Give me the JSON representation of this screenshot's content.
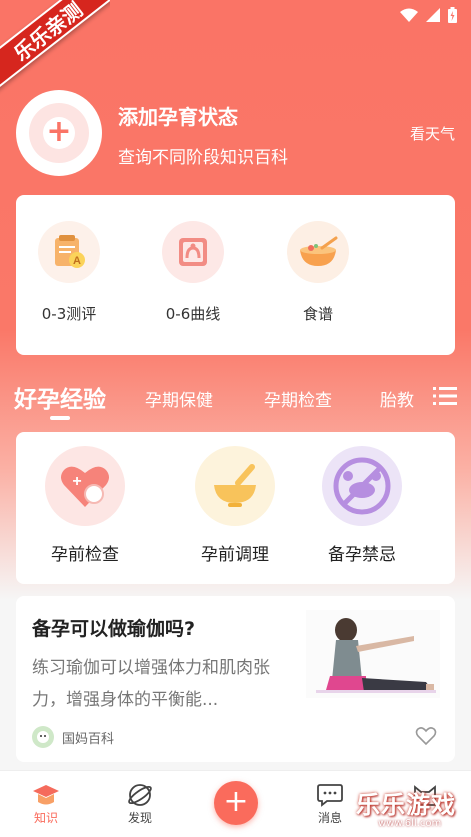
{
  "ribbon": {
    "text": "乐乐亲测"
  },
  "header": {
    "title": "添加孕育状态",
    "subtitle": "查询不同阶段知识百科",
    "weather_link": "看天气"
  },
  "tools": [
    {
      "label": "0-3测评",
      "icon": "assessment-icon"
    },
    {
      "label": "0-6曲线",
      "icon": "growth-curve-icon"
    },
    {
      "label": "食谱",
      "icon": "recipe-bowl-icon"
    }
  ],
  "tabs": [
    {
      "label": "好孕经验",
      "active": true
    },
    {
      "label": "孕期保健",
      "active": false
    },
    {
      "label": "孕期检查",
      "active": false
    },
    {
      "label": "胎教",
      "active": false
    }
  ],
  "categories": [
    {
      "label": "孕前检查",
      "icon": "heart-check-icon",
      "bg": "#fde6e4"
    },
    {
      "label": "孕前调理",
      "icon": "mortar-bowl-icon",
      "bg": "#fdf3dc"
    },
    {
      "label": "备孕禁忌",
      "icon": "no-crab-icon",
      "bg": "#ece4f7"
    }
  ],
  "article": {
    "title": "备孕可以做瑜伽吗?",
    "desc": "练习瑜伽可以增强体力和肌肉张力，增强身体的平衡能...",
    "author": "国妈百科"
  },
  "nav": {
    "knowledge": "知识",
    "discover": "发现",
    "add": "+",
    "messages": "消息"
  },
  "watermark": {
    "text": "乐乐游戏",
    "url": "www.6ll.com"
  },
  "colors": {
    "accent": "#fa7466",
    "brand_red": "#fa6b5c"
  }
}
